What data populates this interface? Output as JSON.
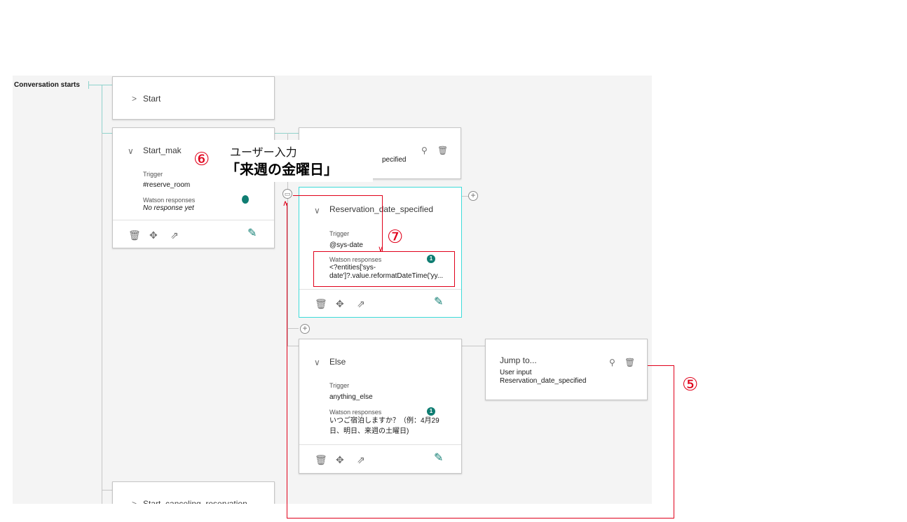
{
  "root_label": "Conversation starts",
  "nodes": {
    "start": {
      "chevron": ">",
      "title": "Start"
    },
    "start_mak": {
      "chevron": "∨",
      "title": "Start_mak",
      "trigger_label": "Trigger",
      "trigger": "#reserve_room",
      "responses_label": "Watson responses",
      "responses": "No response yet"
    },
    "date_specified_partial": {
      "title": "pecified"
    },
    "reservation": {
      "chevron": "∨",
      "title": "Reservation_date_specified",
      "trigger_label": "Trigger",
      "trigger": "@sys-date",
      "responses_label": "Watson responses",
      "badge": "1",
      "response_line1": "<?entities['sys-",
      "response_line2": "date']?.value.reformatDateTime('yy..."
    },
    "else": {
      "chevron": "∨",
      "title": "Else",
      "trigger_label": "Trigger",
      "trigger": "anything_else",
      "responses_label": "Watson responses",
      "badge": "1",
      "response_line1": "いつご宿泊しますか？（例：4月29",
      "response_line2": "日、明日、来週の土曜日)"
    },
    "jump": {
      "title": "Jump to...",
      "line1": "User input",
      "line2": "Reservation_date_specified"
    },
    "canceling": {
      "chevron": ">",
      "title": "Start_canceling_reservation"
    }
  },
  "annotations": {
    "five": "⑤",
    "six": "⑥",
    "seven": "⑦",
    "user_input_label": "ユーザー入力",
    "user_input_value": "「来週の金曜日」"
  },
  "icons": {
    "delete": "trash-icon",
    "move": "move-icon",
    "jump": "jump-to-icon",
    "edit": "pencil-icon",
    "link": "link-icon",
    "add": "add-icon",
    "comment": "comment-icon"
  },
  "colors": {
    "accent": "#0f7d72",
    "selected_border": "#3ddbd9",
    "annotation_red": "#e0001a"
  }
}
